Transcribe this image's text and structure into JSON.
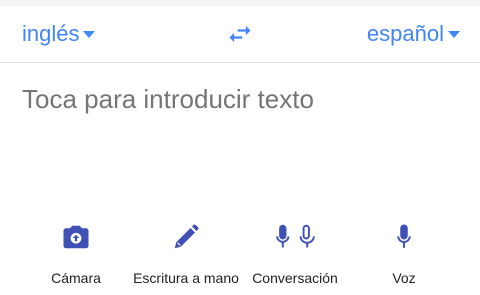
{
  "language_bar": {
    "source_language": "inglés",
    "target_language": "español",
    "swap_icon": "swap-arrows-icon"
  },
  "input": {
    "placeholder": "Toca para introducir texto"
  },
  "tools": [
    {
      "label": "Cámara",
      "icon": "camera-icon"
    },
    {
      "label": "Escritura a mano",
      "icon": "pen-icon"
    },
    {
      "label": "Conversación",
      "icon": "dual-mic-icon"
    },
    {
      "label": "Voz",
      "icon": "mic-icon"
    }
  ],
  "colors": {
    "accent": "#4285f4",
    "icon": "#3f51b5",
    "placeholder_text": "#757575",
    "label_text": "#212121"
  }
}
